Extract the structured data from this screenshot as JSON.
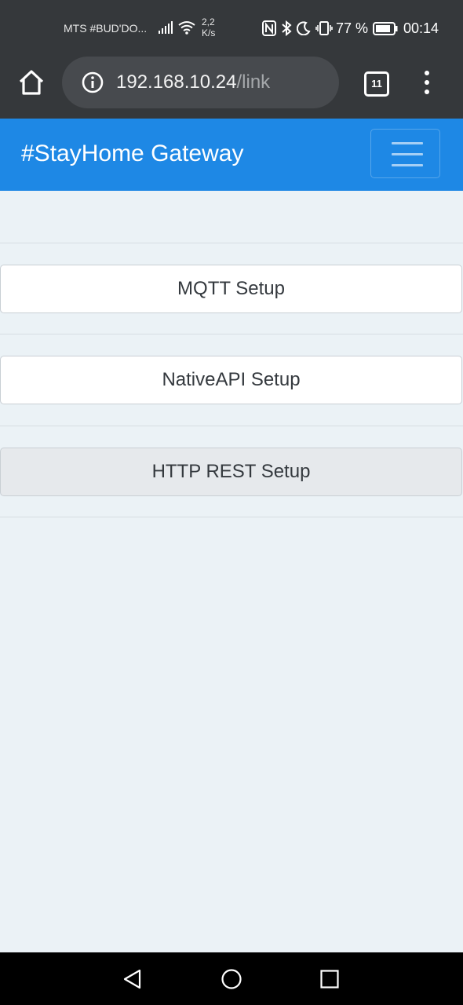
{
  "status_bar": {
    "carrier": "MTS #BUD'DO...",
    "speed_value": "2,2",
    "speed_unit": "K/s",
    "battery_percent": "77 %",
    "time": "00:14",
    "icons": [
      "signal-icon",
      "wifi-icon",
      "nfc-icon",
      "bluetooth-icon",
      "moon-icon",
      "vibrate-icon",
      "battery-icon"
    ]
  },
  "browser": {
    "url_host": "192.168.10.24",
    "url_path": "/link",
    "tab_count": "11"
  },
  "navbar": {
    "brand": "#StayHome Gateway"
  },
  "buttons": [
    {
      "label": "MQTT Setup"
    },
    {
      "label": "NativeAPI Setup"
    },
    {
      "label": "HTTP REST Setup"
    }
  ],
  "colors": {
    "navbar": "#1e88e5",
    "page_background": "#ebf2f6",
    "browser_chrome": "#35383b"
  }
}
